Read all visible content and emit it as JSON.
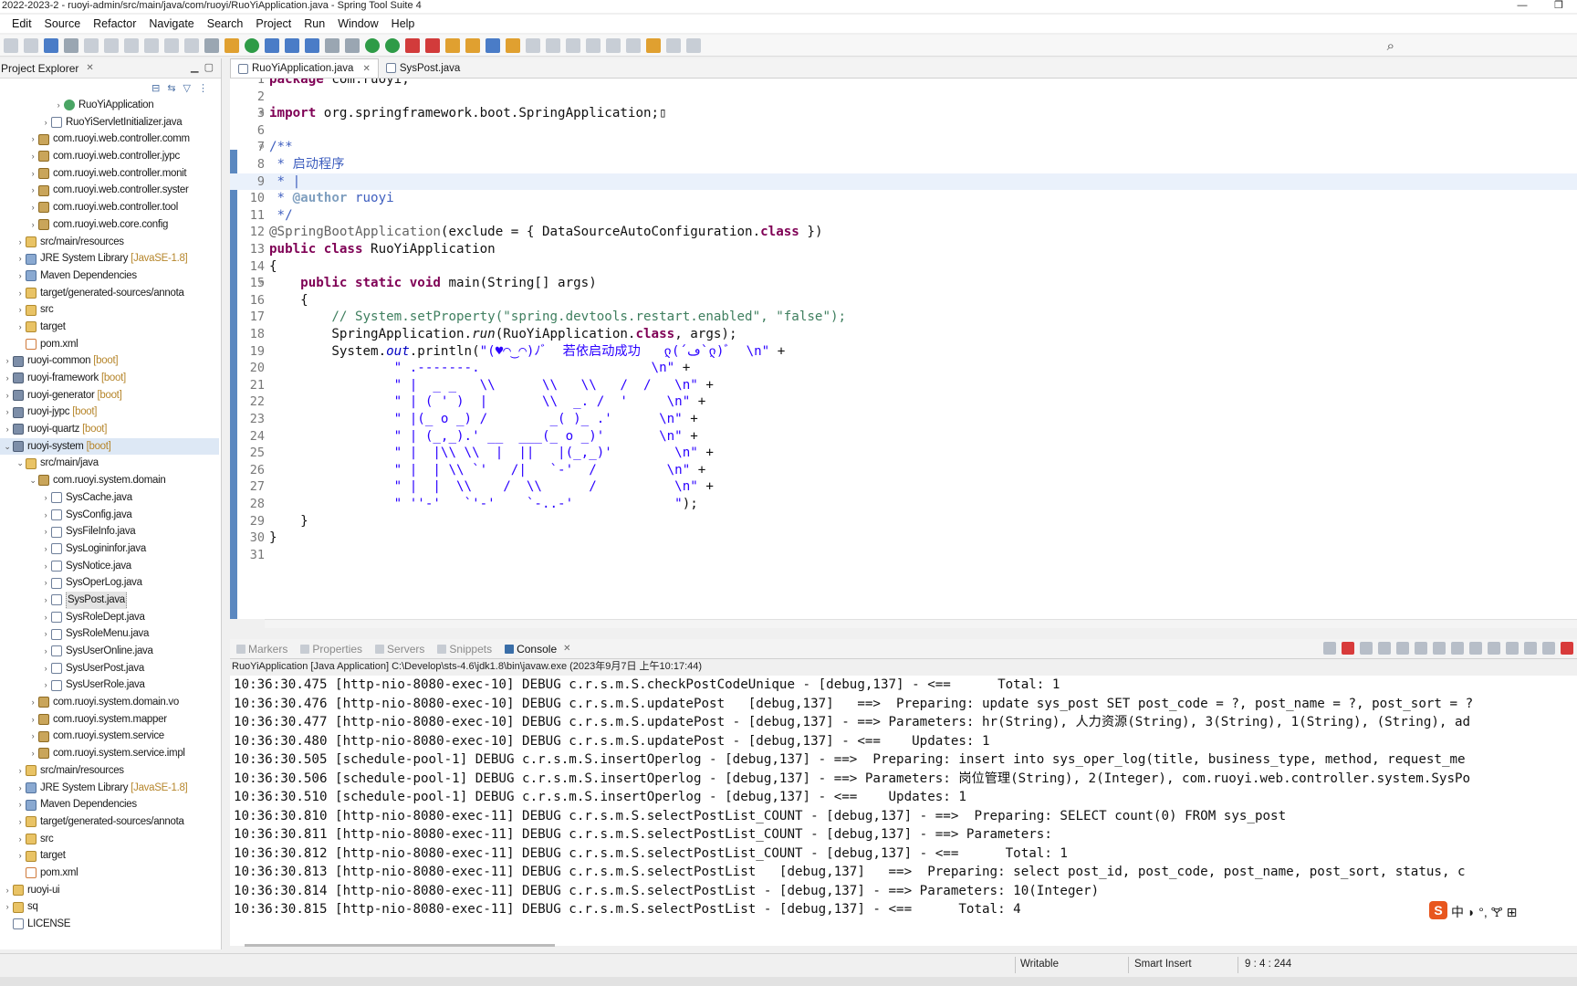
{
  "window": {
    "title": "2022-2023-2 - ruoyi-admin/src/main/java/com/ruoyi/RuoYiApplication.java - Spring Tool Suite 4"
  },
  "menu": [
    "Edit",
    "Source",
    "Refactor",
    "Navigate",
    "Search",
    "Project",
    "Run",
    "Window",
    "Help"
  ],
  "explorer": {
    "title": "Project Explorer",
    "rows": [
      {
        "indent": 4,
        "arrow": "›",
        "icon": "run",
        "label": "RuoYiApplication",
        "tag": ""
      },
      {
        "indent": 3,
        "arrow": "›",
        "icon": "jav",
        "label": "RuoYiServletInitializer.java",
        "tag": ""
      },
      {
        "indent": 2,
        "arrow": "›",
        "icon": "pkg",
        "label": "com.ruoyi.web.controller.comm",
        "tag": ""
      },
      {
        "indent": 2,
        "arrow": "›",
        "icon": "pkg",
        "label": "com.ruoyi.web.controller.jypc",
        "tag": ""
      },
      {
        "indent": 2,
        "arrow": "›",
        "icon": "pkg",
        "label": "com.ruoyi.web.controller.monit",
        "tag": ""
      },
      {
        "indent": 2,
        "arrow": "›",
        "icon": "pkg",
        "label": "com.ruoyi.web.controller.syster",
        "tag": ""
      },
      {
        "indent": 2,
        "arrow": "›",
        "icon": "pkg",
        "label": "com.ruoyi.web.controller.tool",
        "tag": ""
      },
      {
        "indent": 2,
        "arrow": "›",
        "icon": "pkg",
        "label": "com.ruoyi.web.core.config",
        "tag": ""
      },
      {
        "indent": 1,
        "arrow": "›",
        "icon": "fld",
        "label": "src/main/resources",
        "tag": ""
      },
      {
        "indent": 1,
        "arrow": "›",
        "icon": "lib",
        "label": "JRE System Library",
        "tag": "[JavaSE-1.8]"
      },
      {
        "indent": 1,
        "arrow": "›",
        "icon": "lib",
        "label": "Maven Dependencies",
        "tag": ""
      },
      {
        "indent": 1,
        "arrow": "›",
        "icon": "fld",
        "label": "target/generated-sources/annota",
        "tag": ""
      },
      {
        "indent": 1,
        "arrow": "›",
        "icon": "fld",
        "label": "src",
        "tag": ""
      },
      {
        "indent": 1,
        "arrow": "›",
        "icon": "fld",
        "label": "target",
        "tag": ""
      },
      {
        "indent": 1,
        "arrow": "",
        "icon": "xml",
        "label": "pom.xml",
        "tag": ""
      },
      {
        "indent": 0,
        "arrow": "›",
        "icon": "prj",
        "label": "ruoyi-common",
        "tag": "[boot]"
      },
      {
        "indent": 0,
        "arrow": "›",
        "icon": "prj",
        "label": "ruoyi-framework",
        "tag": "[boot]"
      },
      {
        "indent": 0,
        "arrow": "›",
        "icon": "prj",
        "label": "ruoyi-generator",
        "tag": "[boot]"
      },
      {
        "indent": 0,
        "arrow": "›",
        "icon": "prj",
        "label": "ruoyi-jypc",
        "tag": "[boot]"
      },
      {
        "indent": 0,
        "arrow": "›",
        "icon": "prj",
        "label": "ruoyi-quartz",
        "tag": "[boot]"
      },
      {
        "indent": 0,
        "arrow": "⌄",
        "icon": "prj",
        "label": "ruoyi-system",
        "tag": "[boot]",
        "selected": true
      },
      {
        "indent": 1,
        "arrow": "⌄",
        "icon": "fld",
        "label": "src/main/java",
        "tag": ""
      },
      {
        "indent": 2,
        "arrow": "⌄",
        "icon": "pkg",
        "label": "com.ruoyi.system.domain",
        "tag": ""
      },
      {
        "indent": 3,
        "arrow": "›",
        "icon": "jav",
        "label": "SysCache.java",
        "tag": ""
      },
      {
        "indent": 3,
        "arrow": "›",
        "icon": "jav",
        "label": "SysConfig.java",
        "tag": ""
      },
      {
        "indent": 3,
        "arrow": "›",
        "icon": "jav",
        "label": "SysFileInfo.java",
        "tag": ""
      },
      {
        "indent": 3,
        "arrow": "›",
        "icon": "jav",
        "label": "SysLogininfor.java",
        "tag": ""
      },
      {
        "indent": 3,
        "arrow": "›",
        "icon": "jav",
        "label": "SysNotice.java",
        "tag": ""
      },
      {
        "indent": 3,
        "arrow": "›",
        "icon": "jav",
        "label": "SysOperLog.java",
        "tag": ""
      },
      {
        "indent": 3,
        "arrow": "›",
        "icon": "jav",
        "label": "SysPost.java",
        "tag": "",
        "focused": true
      },
      {
        "indent": 3,
        "arrow": "›",
        "icon": "jav",
        "label": "SysRoleDept.java",
        "tag": ""
      },
      {
        "indent": 3,
        "arrow": "›",
        "icon": "jav",
        "label": "SysRoleMenu.java",
        "tag": ""
      },
      {
        "indent": 3,
        "arrow": "›",
        "icon": "jav",
        "label": "SysUserOnline.java",
        "tag": ""
      },
      {
        "indent": 3,
        "arrow": "›",
        "icon": "jav",
        "label": "SysUserPost.java",
        "tag": ""
      },
      {
        "indent": 3,
        "arrow": "›",
        "icon": "jav",
        "label": "SysUserRole.java",
        "tag": ""
      },
      {
        "indent": 2,
        "arrow": "›",
        "icon": "pkg",
        "label": "com.ruoyi.system.domain.vo",
        "tag": ""
      },
      {
        "indent": 2,
        "arrow": "›",
        "icon": "pkg",
        "label": "com.ruoyi.system.mapper",
        "tag": ""
      },
      {
        "indent": 2,
        "arrow": "›",
        "icon": "pkg",
        "label": "com.ruoyi.system.service",
        "tag": ""
      },
      {
        "indent": 2,
        "arrow": "›",
        "icon": "pkg",
        "label": "com.ruoyi.system.service.impl",
        "tag": ""
      },
      {
        "indent": 1,
        "arrow": "›",
        "icon": "fld",
        "label": "src/main/resources",
        "tag": ""
      },
      {
        "indent": 1,
        "arrow": "›",
        "icon": "lib",
        "label": "JRE System Library",
        "tag": "[JavaSE-1.8]"
      },
      {
        "indent": 1,
        "arrow": "›",
        "icon": "lib",
        "label": "Maven Dependencies",
        "tag": ""
      },
      {
        "indent": 1,
        "arrow": "›",
        "icon": "fld",
        "label": "target/generated-sources/annota",
        "tag": ""
      },
      {
        "indent": 1,
        "arrow": "›",
        "icon": "fld",
        "label": "src",
        "tag": ""
      },
      {
        "indent": 1,
        "arrow": "›",
        "icon": "fld",
        "label": "target",
        "tag": ""
      },
      {
        "indent": 1,
        "arrow": "",
        "icon": "xml",
        "label": "pom.xml",
        "tag": ""
      },
      {
        "indent": 0,
        "arrow": "›",
        "icon": "fld",
        "label": "ruoyi-ui",
        "tag": ""
      },
      {
        "indent": 0,
        "arrow": "›",
        "icon": "fld",
        "label": "sq",
        "tag": ""
      },
      {
        "indent": 0,
        "arrow": "",
        "icon": "jav",
        "label": "LICENSE",
        "tag": ""
      }
    ]
  },
  "editor": {
    "tabs": [
      {
        "label": "RuoYiApplication.java",
        "active": true
      },
      {
        "label": "SysPost.java",
        "active": false
      }
    ],
    "current_line": 9,
    "lines": [
      {
        "n": "1",
        "fold": "",
        "html": "<span class=\"kw\">package</span> com.ruoyi;"
      },
      {
        "n": "2",
        "fold": "",
        "html": ""
      },
      {
        "n": "3",
        "fold": "⊕",
        "html": "<span class=\"kw\">import</span> org.springframework.boot.SpringApplication;▯"
      },
      {
        "n": "6",
        "fold": "",
        "html": ""
      },
      {
        "n": "7",
        "fold": "⊖",
        "html": "<span class=\"jd\">/**</span>"
      },
      {
        "n": "8",
        "fold": "",
        "html": "<span class=\"jd\"> * 启动程序</span>"
      },
      {
        "n": "9",
        "fold": "",
        "html": "<span class=\"jd\"> * |</span>"
      },
      {
        "n": "10",
        "fold": "",
        "html": "<span class=\"jd\"> * <b style=\"color:#7f9fbf;font-weight:bold\">@author</b> ruoyi</span>"
      },
      {
        "n": "11",
        "fold": "",
        "html": "<span class=\"jd\"> */</span>"
      },
      {
        "n": "12",
        "fold": "",
        "html": "<span class=\"an\">@SpringBootApplication</span>(exclude = { DataSourceAutoConfiguration.<span class=\"kw\">class</span> })"
      },
      {
        "n": "13",
        "fold": "",
        "html": "<span class=\"kw\">public class</span> RuoYiApplication"
      },
      {
        "n": "14",
        "fold": "",
        "html": "{"
      },
      {
        "n": "15",
        "fold": "⊖",
        "html": "    <span class=\"kw\">public static void</span> main(String[] args)"
      },
      {
        "n": "16",
        "fold": "",
        "html": "    {"
      },
      {
        "n": "17",
        "fold": "",
        "html": "        <span class=\"cm\">// System.setProperty(\"spring.devtools.restart.enabled\", \"false\");</span>"
      },
      {
        "n": "18",
        "fold": "",
        "html": "        SpringApplication.<span class=\"it\">run</span>(RuoYiApplication.<span class=\"kw\">class</span>, args);"
      },
      {
        "n": "19",
        "fold": "",
        "html": "        System.<span class=\"it\" style=\"color:#0000c0\">out</span>.println(<span class=\"st\">\"(♥◠‿◠)ﾉﾞ  若依启动成功   ლ(´ڡ`ლ)ﾞ  \\n\"</span> +"
      },
      {
        "n": "20",
        "fold": "",
        "html": "                <span class=\"st\">\" .-------.                      \\n\"</span> +"
      },
      {
        "n": "21",
        "fold": "",
        "html": "                <span class=\"st\">\" |  _ _   \\\\      \\\\   \\\\   /  /   \\n\"</span> +"
      },
      {
        "n": "22",
        "fold": "",
        "html": "                <span class=\"st\">\" | ( ' )  |       \\\\  _. /  '     \\n\"</span> +"
      },
      {
        "n": "23",
        "fold": "",
        "html": "                <span class=\"st\">\" |(_ o _) /        _( )_ .'      \\n\"</span> +"
      },
      {
        "n": "24",
        "fold": "",
        "html": "                <span class=\"st\">\" | (_,_).' __  ___(_ o _)'       \\n\"</span> +"
      },
      {
        "n": "25",
        "fold": "",
        "html": "                <span class=\"st\">\" |  |\\\\ \\\\  |  ||   |(_,_)'        \\n\"</span> +"
      },
      {
        "n": "26",
        "fold": "",
        "html": "                <span class=\"st\">\" |  | \\\\ `'   /|   `-'  /         \\n\"</span> +"
      },
      {
        "n": "27",
        "fold": "",
        "html": "                <span class=\"st\">\" |  |  \\\\    /  \\\\      /          \\n\"</span> +"
      },
      {
        "n": "28",
        "fold": "",
        "html": "                <span class=\"st\">\" ''-'   `'-'    `-..-'             \"</span>);"
      },
      {
        "n": "29",
        "fold": "",
        "html": "    }"
      },
      {
        "n": "30",
        "fold": "",
        "html": "}"
      },
      {
        "n": "31",
        "fold": "",
        "html": ""
      }
    ]
  },
  "console": {
    "tabs": [
      "Markers",
      "Properties",
      "Servers",
      "Snippets",
      "Console"
    ],
    "active_tab": "Console",
    "info": "RuoYiApplication [Java Application] C:\\Develop\\sts-4.6\\jdk1.8\\bin\\javaw.exe  (2023年9月7日 上午10:17:44)",
    "lines": [
      "10:36:30.475 [http-nio-8080-exec-10] DEBUG c.r.s.m.S.checkPostCodeUnique - [debug,137] - <==      Total: 1",
      "10:36:30.476 [http-nio-8080-exec-10] DEBUG c.r.s.m.S.updatePost   [debug,137]   ==>  Preparing: update sys_post SET post_code = ?, post_name = ?, post_sort = ?",
      "10:36:30.477 [http-nio-8080-exec-10] DEBUG c.r.s.m.S.updatePost - [debug,137] - ==> Parameters: hr(String), 人力资源(String), 3(String), 1(String), (String), ad",
      "10:36:30.480 [http-nio-8080-exec-10] DEBUG c.r.s.m.S.updatePost - [debug,137] - <==    Updates: 1",
      "10:36:30.505 [schedule-pool-1] DEBUG c.r.s.m.S.insertOperlog - [debug,137] - ==>  Preparing: insert into sys_oper_log(title, business_type, method, request_me",
      "10:36:30.506 [schedule-pool-1] DEBUG c.r.s.m.S.insertOperlog - [debug,137] - ==> Parameters: 岗位管理(String), 2(Integer), com.ruoyi.web.controller.system.SysPo",
      "10:36:30.510 [schedule-pool-1] DEBUG c.r.s.m.S.insertOperlog - [debug,137] - <==    Updates: 1",
      "10:36:30.810 [http-nio-8080-exec-11] DEBUG c.r.s.m.S.selectPostList_COUNT - [debug,137] - ==>  Preparing: SELECT count(0) FROM sys_post",
      "10:36:30.811 [http-nio-8080-exec-11] DEBUG c.r.s.m.S.selectPostList_COUNT - [debug,137] - ==> Parameters: ",
      "10:36:30.812 [http-nio-8080-exec-11] DEBUG c.r.s.m.S.selectPostList_COUNT - [debug,137] - <==      Total: 1",
      "10:36:30.813 [http-nio-8080-exec-11] DEBUG c.r.s.m.S.selectPostList   [debug,137]   ==>  Preparing: select post_id, post_code, post_name, post_sort, status, c",
      "10:36:30.814 [http-nio-8080-exec-11] DEBUG c.r.s.m.S.selectPostList - [debug,137] - ==> Parameters: 10(Integer)",
      "10:36:30.815 [http-nio-8080-exec-11] DEBUG c.r.s.m.S.selectPostList - [debug,137] - <==      Total: 4"
    ],
    "ime": "中 ◗ °, 🝖 ⊞"
  },
  "status": {
    "writable": "Writable",
    "insert_mode": "Smart Insert",
    "position": "9 : 4 : 244"
  }
}
